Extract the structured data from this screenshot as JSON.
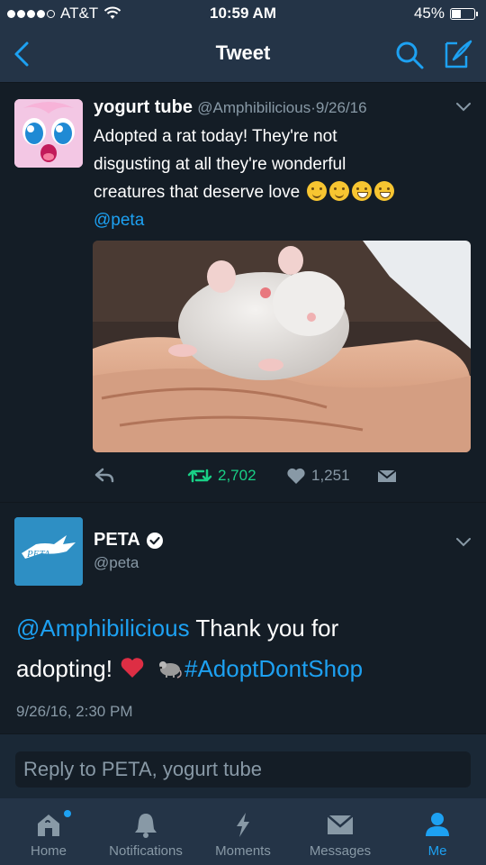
{
  "status_bar": {
    "carrier": "AT&T",
    "time": "10:59 AM",
    "battery_percent": "45%",
    "battery_level": 0.45
  },
  "nav": {
    "title": "Tweet",
    "back_icon": "chevron-left-icon",
    "search_icon": "search-icon",
    "compose_icon": "compose-icon"
  },
  "tweet1": {
    "name": "yogurt tube",
    "handle": "@Amphibilicious",
    "separator": "·",
    "date": "9/26/16",
    "lines": [
      "Adopted a rat today! They're not",
      "disgusting at all they're wonderful",
      "creatures that deserve love"
    ],
    "mention": "@peta",
    "emojis": [
      "smiling-face",
      "smiling-face",
      "grinning-face",
      "grinning-face"
    ],
    "retweets": "2,702",
    "likes": "1,251"
  },
  "tweet2": {
    "name": "PETA",
    "verified": true,
    "handle": "@peta",
    "avatar_text": "PETA",
    "mention": "@Amphibilicious",
    "text_part1": " Thank you for",
    "text_part2": "adopting!",
    "hashtag": "#AdoptDontShop",
    "timestamp": "9/26/16, 2:30 PM"
  },
  "reply": {
    "placeholder": "Reply to PETA, yogurt tube"
  },
  "tabs": [
    {
      "label": "Home",
      "icon": "home-icon"
    },
    {
      "label": "Notifications",
      "icon": "bell-icon"
    },
    {
      "label": "Moments",
      "icon": "lightning-icon"
    },
    {
      "label": "Messages",
      "icon": "envelope-icon"
    },
    {
      "label": "Me",
      "icon": "person-icon"
    }
  ],
  "colors": {
    "background": "#141d26",
    "bar": "#243447",
    "accent": "#1da1f2",
    "retweet": "#19cf86",
    "muted": "#8899a6"
  }
}
